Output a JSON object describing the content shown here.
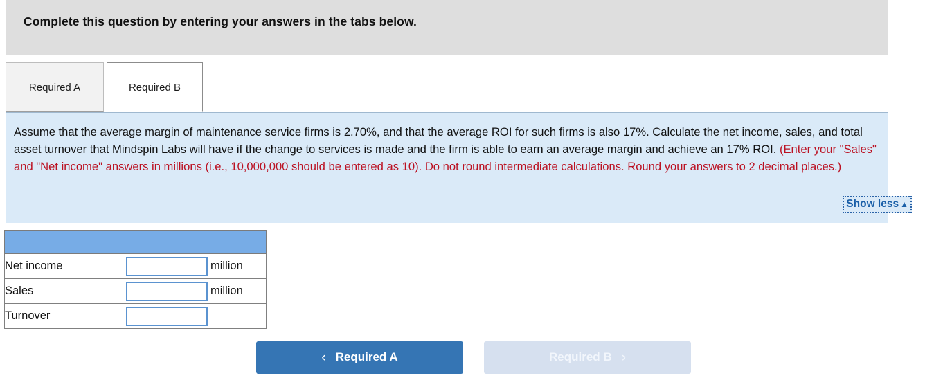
{
  "banner": {
    "title": "Complete this question by entering your answers in the tabs below."
  },
  "tabs": [
    {
      "label": "Required A",
      "active": false
    },
    {
      "label": "Required B",
      "active": true
    }
  ],
  "question": {
    "text_part1": "Assume that the average margin of maintenance service firms is 2.70%, and that the average ROI for such firms is also 17%. Calculate the net income, sales, and total asset turnover that Mindspin Labs will have if the change to services is made and the firm is able to earn an average margin and achieve an 17% ROI. ",
    "text_part2_red": "(Enter your \"Sales\" and \"Net income\" answers in millions (i.e., 10,000,000 should be entered as 10). Do not round intermediate calculations. Round your answers to 2 decimal places.)",
    "show_less_label": "Show less",
    "show_less_caret": "▲"
  },
  "table": {
    "header": [
      "",
      "",
      ""
    ],
    "rows": [
      {
        "label": "Net income",
        "value": "",
        "unit": "million"
      },
      {
        "label": "Sales",
        "value": "",
        "unit": "million"
      },
      {
        "label": "Turnover",
        "value": "",
        "unit": ""
      }
    ]
  },
  "nav": {
    "prev_label": "Required A",
    "prev_chevron": "‹",
    "next_label": "Required B",
    "next_chevron": "›"
  },
  "colors": {
    "banner_bg": "#dedede",
    "panel_bg": "#daeaf8",
    "table_header_bg": "#77ace6",
    "input_border": "#5b93d0",
    "accent_blue": "#3575b4",
    "disabled_blue": "#d6e0ef",
    "red_text": "#bb1122",
    "link_blue": "#1a5fa8"
  }
}
